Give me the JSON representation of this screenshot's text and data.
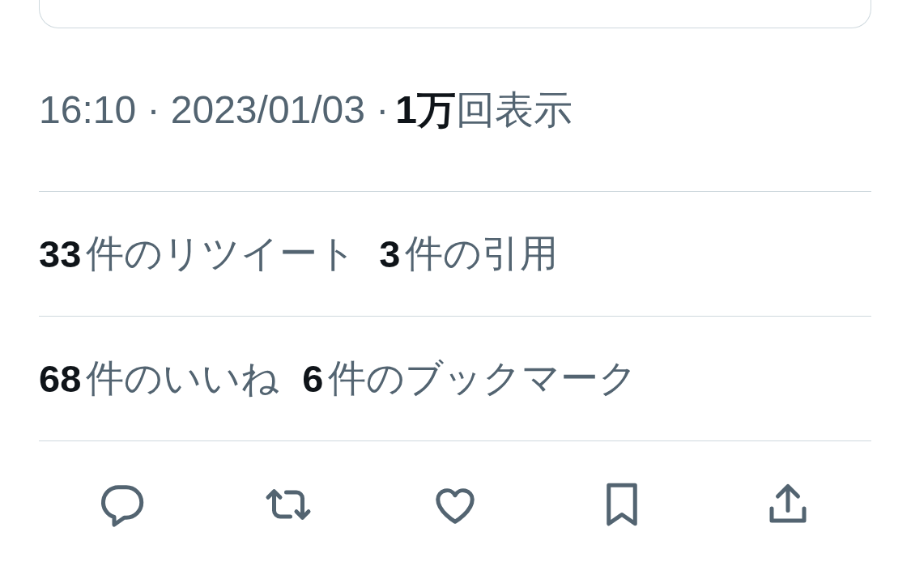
{
  "timestamp": {
    "text": "16:10 · 2023/01/03 ·",
    "views_count": "1万",
    "views_label": "回表示"
  },
  "stats_rows": [
    [
      {
        "count": "33",
        "label": "件のリツイート"
      },
      {
        "count": "3",
        "label": "件の引用"
      }
    ],
    [
      {
        "count": "68",
        "label": "件のいいね"
      },
      {
        "count": "6",
        "label": "件のブックマーク"
      }
    ]
  ],
  "actions": [
    {
      "kind": "reply"
    },
    {
      "kind": "retweet"
    },
    {
      "kind": "like"
    },
    {
      "kind": "bookmark"
    },
    {
      "kind": "share"
    }
  ]
}
